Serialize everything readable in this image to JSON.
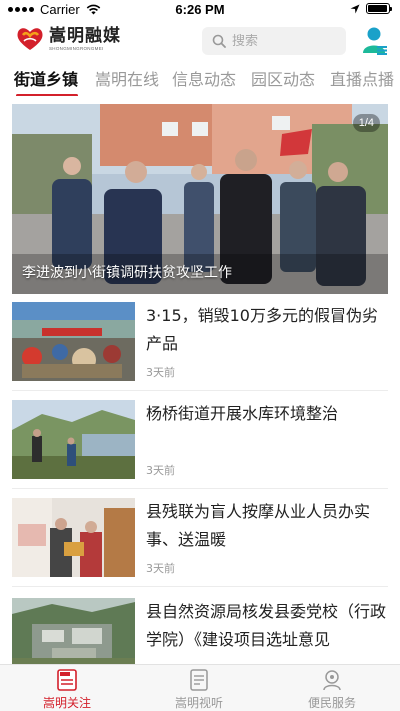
{
  "status_bar": {
    "carrier": "Carrier",
    "time": "6:26 PM",
    "battery_level": 0.95
  },
  "header": {
    "logo_cn": "嵩明融媒",
    "logo_en": "SHONGMINGRONGMEI",
    "search_placeholder": "搜索",
    "icons": [
      "search-icon",
      "user-icon"
    ],
    "accent_color": "#d3202b"
  },
  "tabs": [
    {
      "label": "街道乡镇",
      "active": true
    },
    {
      "label": "嵩明在线",
      "active": false
    },
    {
      "label": "信息动态",
      "active": false
    },
    {
      "label": "园区动态",
      "active": false
    },
    {
      "label": "直播点播",
      "active": false
    }
  ],
  "hero": {
    "caption": "李进波到小街镇调研扶贫攻坚工作",
    "counter": "1/4"
  },
  "news": [
    {
      "title": "3·15，销毁10万多元的假冒伪劣产品",
      "time": "3天前"
    },
    {
      "title": "杨桥街道开展水库环境整治",
      "time": "3天前"
    },
    {
      "title": "县残联为盲人按摩从业人员办实事、送温暖",
      "time": "3天前"
    },
    {
      "title": "县自然资源局核发县委党校（行政学院）《建设项目选址意见",
      "time": ""
    }
  ],
  "bottom_nav": [
    {
      "label": "嵩明关注",
      "icon": "news-icon",
      "active": true
    },
    {
      "label": "嵩明视听",
      "icon": "video-icon",
      "active": false
    },
    {
      "label": "便民服务",
      "icon": "service-icon",
      "active": false
    }
  ]
}
